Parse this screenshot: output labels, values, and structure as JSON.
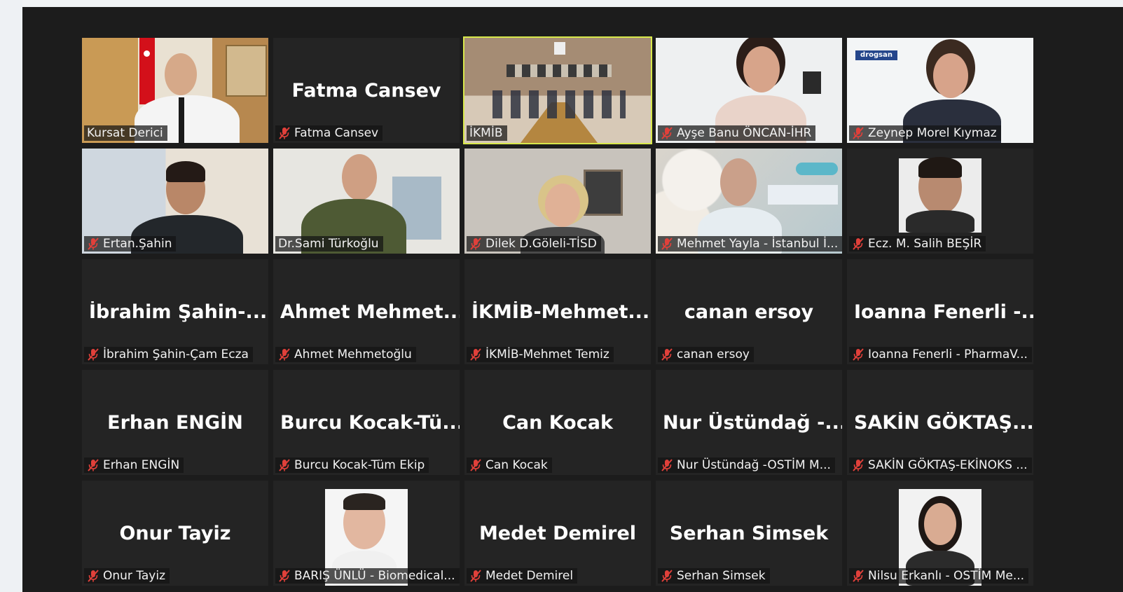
{
  "participants": [
    {
      "display_name": "",
      "label": "Kursat Derici",
      "muted": false,
      "video": "office-flag"
    },
    {
      "display_name": "Fatma Cansev",
      "label": "Fatma Cansev",
      "muted": true,
      "video": "none"
    },
    {
      "display_name": "",
      "label": "İKMİB",
      "muted": false,
      "video": "meeting-room",
      "active_speaker": true
    },
    {
      "display_name": "",
      "label": "Ayşe Banu ÖNCAN-İHR",
      "muted": true,
      "video": "woman-glasses"
    },
    {
      "display_name": "",
      "label": "Zeynep Morel Kıymaz",
      "muted": true,
      "video": "woman-office"
    },
    {
      "display_name": "",
      "label": "Ertan.Şahin",
      "muted": true,
      "video": "man-office"
    },
    {
      "display_name": "",
      "label": "Dr.Sami Türkoğlu",
      "muted": false,
      "video": "man-green"
    },
    {
      "display_name": "",
      "label": "Dilek D.Göleli-TİSD",
      "muted": true,
      "video": "woman-blonde"
    },
    {
      "display_name": "",
      "label": "Mehmet Yayla - İstanbul İ...",
      "muted": true,
      "video": "man-pills"
    },
    {
      "display_name": "",
      "label": "Ecz. M. Salih BEŞİR",
      "muted": true,
      "video": "photo-man"
    },
    {
      "display_name": "İbrahim Şahin-...",
      "label": "İbrahim Şahin-Çam Ecza",
      "muted": true,
      "video": "none"
    },
    {
      "display_name": "Ahmet Mehmet...",
      "label": "Ahmet Mehmetoğlu",
      "muted": true,
      "video": "none"
    },
    {
      "display_name": "İKMİB-Mehmet...",
      "label": "İKMİB-Mehmet Temiz",
      "muted": true,
      "video": "none"
    },
    {
      "display_name": "canan ersoy",
      "label": "canan ersoy",
      "muted": true,
      "video": "none"
    },
    {
      "display_name": "Ioanna Fenerli -...",
      "label": "Ioanna Fenerli - PharmaV...",
      "muted": true,
      "video": "none"
    },
    {
      "display_name": "Erhan ENGİN",
      "label": "Erhan ENGİN",
      "muted": true,
      "video": "none"
    },
    {
      "display_name": "Burcu Kocak-Tü...",
      "label": "Burcu Kocak-Tüm Ekip",
      "muted": true,
      "video": "none"
    },
    {
      "display_name": "Can Kocak",
      "label": "Can Kocak",
      "muted": true,
      "video": "none"
    },
    {
      "display_name": "Nur Üstündağ -...",
      "label": "Nur Üstündağ -OSTİM M...",
      "muted": true,
      "video": "none"
    },
    {
      "display_name": "SAKİN GÖKTAŞ...",
      "label": "SAKİN GÖKTAŞ-EKİNOKS ...",
      "muted": true,
      "video": "none"
    },
    {
      "display_name": "Onur Tayiz",
      "label": "Onur Tayiz",
      "muted": true,
      "video": "none"
    },
    {
      "display_name": "",
      "label": "BARIŞ ÜNLÜ - Biomedical...",
      "muted": true,
      "video": "photo-man2"
    },
    {
      "display_name": "Medet Demirel",
      "label": "Medet Demirel",
      "muted": true,
      "video": "none"
    },
    {
      "display_name": "Serhan Simsek",
      "label": "Serhan Simsek",
      "muted": true,
      "video": "none"
    },
    {
      "display_name": "",
      "label": "Nilsu Erkanlı - OSTİM Me...",
      "muted": true,
      "video": "photo-woman"
    }
  ],
  "colors": {
    "background": "#1c1c1c",
    "tile": "#242424",
    "active_border": "#d8e84b",
    "muted_icon": "#e0403a"
  },
  "icons": {
    "muted": "microphone-muted-icon"
  }
}
